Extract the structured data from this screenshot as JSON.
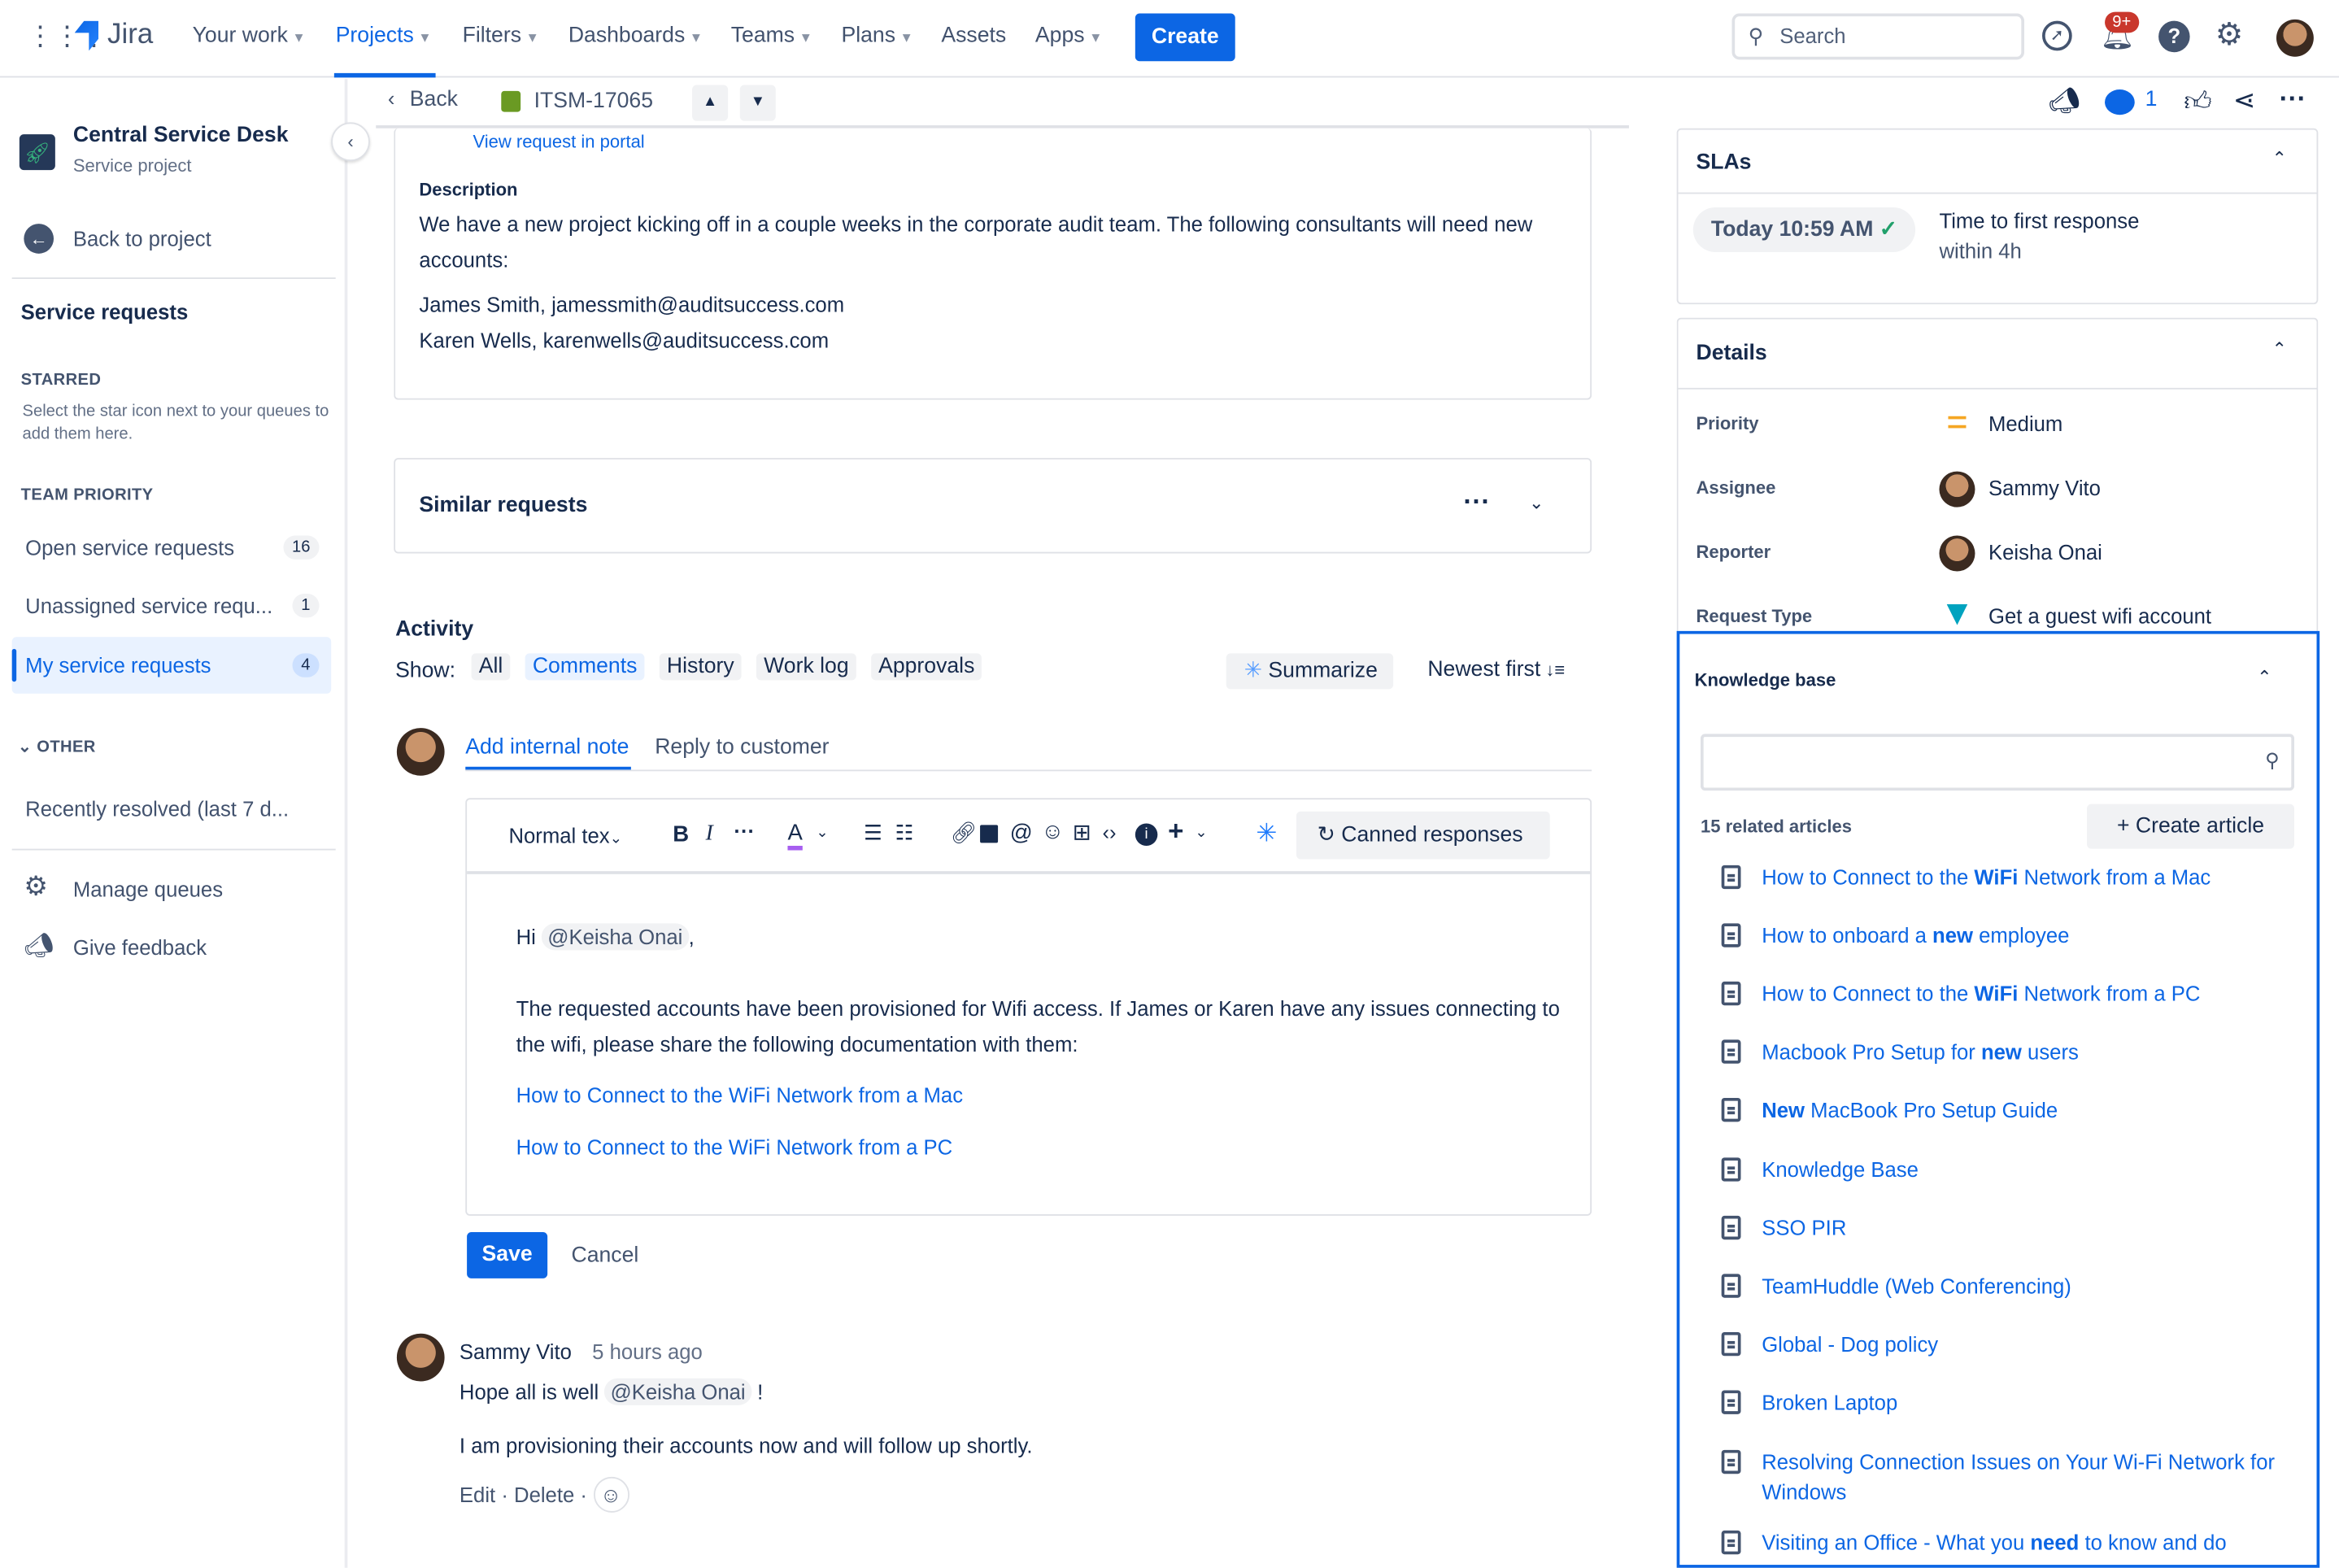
{
  "topnav": {
    "product": "Jira",
    "items": [
      "Your work",
      "Projects",
      "Filters",
      "Dashboards",
      "Teams",
      "Plans",
      "Assets",
      "Apps"
    ],
    "active": "Projects",
    "create_label": "Create",
    "search_placeholder": "Search",
    "notifications_badge": "9+"
  },
  "sidebar": {
    "project_name": "Central Service Desk",
    "project_type": "Service project",
    "back_label": "Back to project",
    "heading": "Service requests",
    "starred_heading": "STARRED",
    "starred_hint": "Select the star icon next to your queues to add them here.",
    "team_priority_heading": "TEAM PRIORITY",
    "queues": [
      {
        "label": "Open service requests",
        "count": "16"
      },
      {
        "label": "Unassigned service requ...",
        "count": "1"
      },
      {
        "label": "My service requests",
        "count": "4"
      }
    ],
    "other_heading": "OTHER",
    "other_items": [
      "Recently resolved (last 7 d..."
    ],
    "manage_queues": "Manage queues",
    "give_feedback": "Give feedback"
  },
  "issue_header": {
    "back_label": "Back",
    "issue_key": "ITSM-17065",
    "watchers_count": "1"
  },
  "main": {
    "view_portal": "View request in portal",
    "description_label": "Description",
    "description_lines": [
      "We have a new project kicking off in a couple weeks in the corporate audit team. The following consultants will need new accounts:",
      "James Smith, jamessmith@auditsuccess.com",
      "Karen Wells, karenwells@auditsuccess.com"
    ],
    "similar_requests": "Similar requests",
    "activity_label": "Activity",
    "show_label": "Show:",
    "filters": [
      "All",
      "Comments",
      "History",
      "Work log",
      "Approvals"
    ],
    "active_filter": "Comments",
    "summarize": "Summarize",
    "sort": "Newest first",
    "tabs": [
      "Add internal note",
      "Reply to customer"
    ],
    "active_tab": "Add internal note",
    "editor": {
      "text_style": "Normal tex",
      "canned_responses": "Canned responses",
      "greeting": "Hi",
      "mention": "@Keisha Onai",
      "greeting_end": ",",
      "body": "The requested accounts have been provisioned for Wifi access. If James or Karen have any issues connecting to the wifi, please share the following documentation with them:",
      "links": [
        "How to Connect to the WiFi Network from a Mac",
        "How to Connect to the WiFi Network from a PC"
      ]
    },
    "save_label": "Save",
    "cancel_label": "Cancel",
    "comment": {
      "author": "Sammy Vito",
      "time": "5 hours ago",
      "line1_pre": "Hope all is well",
      "mention": "@Keisha Onai",
      "line1_post": "!",
      "line2": "I am provisioning their accounts now and will follow up shortly.",
      "edit": "Edit",
      "delete": "Delete"
    }
  },
  "right": {
    "slas_title": "SLAs",
    "sla_time": "Today 10:59 AM",
    "sla_name": "Time to first response",
    "sla_goal": "within 4h",
    "details_title": "Details",
    "details": [
      {
        "label": "Priority",
        "value": "Medium"
      },
      {
        "label": "Assignee",
        "value": "Sammy Vito"
      },
      {
        "label": "Reporter",
        "value": "Keisha Onai"
      },
      {
        "label": "Request Type",
        "value": "Get a guest wifi account"
      }
    ],
    "kb_title": "Knowledge base",
    "kb_search_value": "",
    "kb_count": "15 related articles",
    "create_article": "Create article",
    "articles": [
      "How to Connect to the WiFi Network from a Mac",
      "How to onboard a new employee",
      "How to Connect to the WiFi Network from a PC",
      "Macbook Pro Setup for new users",
      "New MacBook Pro Setup Guide",
      "Knowledge Base",
      "SSO PIR",
      "TeamHuddle (Web Conferencing)",
      "Global - Dog policy",
      "Broken Laptop",
      "Resolving Connection Issues on Your Wi-Fi Network for Windows",
      "Visiting an Office - What you need to know and do"
    ],
    "highlight_color": "#0c66e4"
  }
}
